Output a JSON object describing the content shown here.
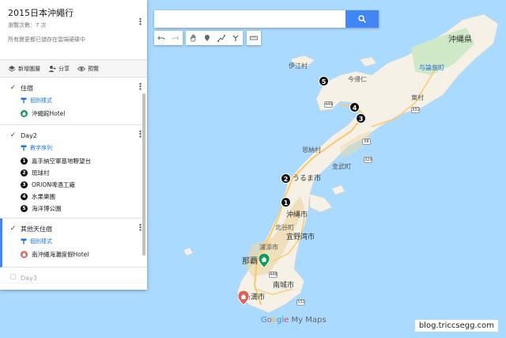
{
  "panel": {
    "title": "2015日本沖繩行",
    "views": "瀏覽次數：7 次",
    "saved_note": "所有變更都已儲存在雲端硬碟中",
    "toolbar": {
      "add_layer": "新增圖層",
      "share": "分享",
      "preview": "預覽"
    },
    "layers": [
      {
        "name": "住宿",
        "style": "個別樣式",
        "items": [
          {
            "label": "沖繩館Hotel",
            "icon": "home-icon",
            "color": "#0f9d58"
          }
        ]
      },
      {
        "name": "Day2",
        "style": "數字序列",
        "items": [
          {
            "num": "1",
            "label": "嘉手納空軍基地瞭望台"
          },
          {
            "num": "2",
            "label": "琉球村"
          },
          {
            "num": "3",
            "label": "ORION啤酒工廠"
          },
          {
            "num": "4",
            "label": "水果樂園"
          },
          {
            "num": "5",
            "label": "海洋博公園"
          }
        ]
      },
      {
        "name": "其他天住宿",
        "style": "個別樣式",
        "items": [
          {
            "label": "南沖繩海灘度假Hotel",
            "icon": "home-icon",
            "color": "#e06055"
          }
        ]
      },
      {
        "name": "Day3"
      }
    ]
  },
  "search": {
    "placeholder": ""
  },
  "map": {
    "labels": {
      "okinawa_pref": "沖縄県",
      "yoronto": "与論島町",
      "iheya": "伊江村",
      "nakijin": "今帰仁",
      "higashi": "東村",
      "onna": "恩納村",
      "kin": "金武町",
      "uruma": "うるま市",
      "okinawa_city": "沖縄市",
      "kitanakagusuku": "北谷町",
      "ginowan": "宜野湾市",
      "urasoe": "浦添市",
      "naha": "那覇",
      "nanjo": "南城市",
      "itoman": "糸満市",
      "ginoza": "金武町"
    },
    "route_numbers": {
      "r1": "58",
      "r2": "331",
      "r3": "329",
      "r4": "449",
      "r5": "449",
      "r6": "331"
    },
    "markers": [
      "1",
      "2",
      "3",
      "4",
      "5"
    ]
  },
  "branding": {
    "google": [
      "G",
      "o",
      "o",
      "g",
      "l",
      "e"
    ],
    "my_maps": "My Maps",
    "watermark": "blog.triccsegg.com"
  },
  "colors": {
    "sea": "#aadaff",
    "land": "#f5f1e6",
    "accent": "#4285f4",
    "road": "#fbc96b"
  }
}
